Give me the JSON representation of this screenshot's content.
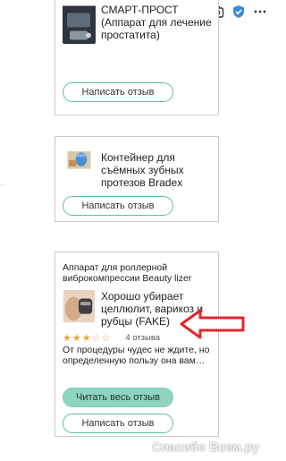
{
  "toolbar": {
    "icons": [
      "search-minus-icon",
      "edit-icon",
      "camera-icon",
      "shield-check-icon",
      "more-icon"
    ],
    "accent": "#3b8ad8"
  },
  "cards": [
    {
      "product_name": "СМАРТ-ПРОСТ (Аппарат для лечение простатита)",
      "write_button": "Написать отзыв"
    },
    {
      "product_name": "Контейнер для съёмных зубных протезов Bradex",
      "write_button": "Написать отзыв"
    },
    {
      "header": "Аппарат для роллерной виброкомпрессии Beauty lizer",
      "product_name": "Хорошо убирает целлюлит, варикоз и рубцы (FAKE)",
      "stars": "★★★☆☆",
      "rating": 3.5,
      "review_count": "4 отзыва",
      "snippet": "От процедуры чудес не ждите, но определенную пользу она вам…",
      "read_button": "Читать весь отзыв",
      "write_button": "Написать отзыв"
    }
  ],
  "watermark": "Спасибо Всем.ру",
  "colors": {
    "button_border": "#5bbfa8",
    "button_fill": "#8fd3c2",
    "star": "#f0a23a",
    "arrow": "#e3252c"
  }
}
